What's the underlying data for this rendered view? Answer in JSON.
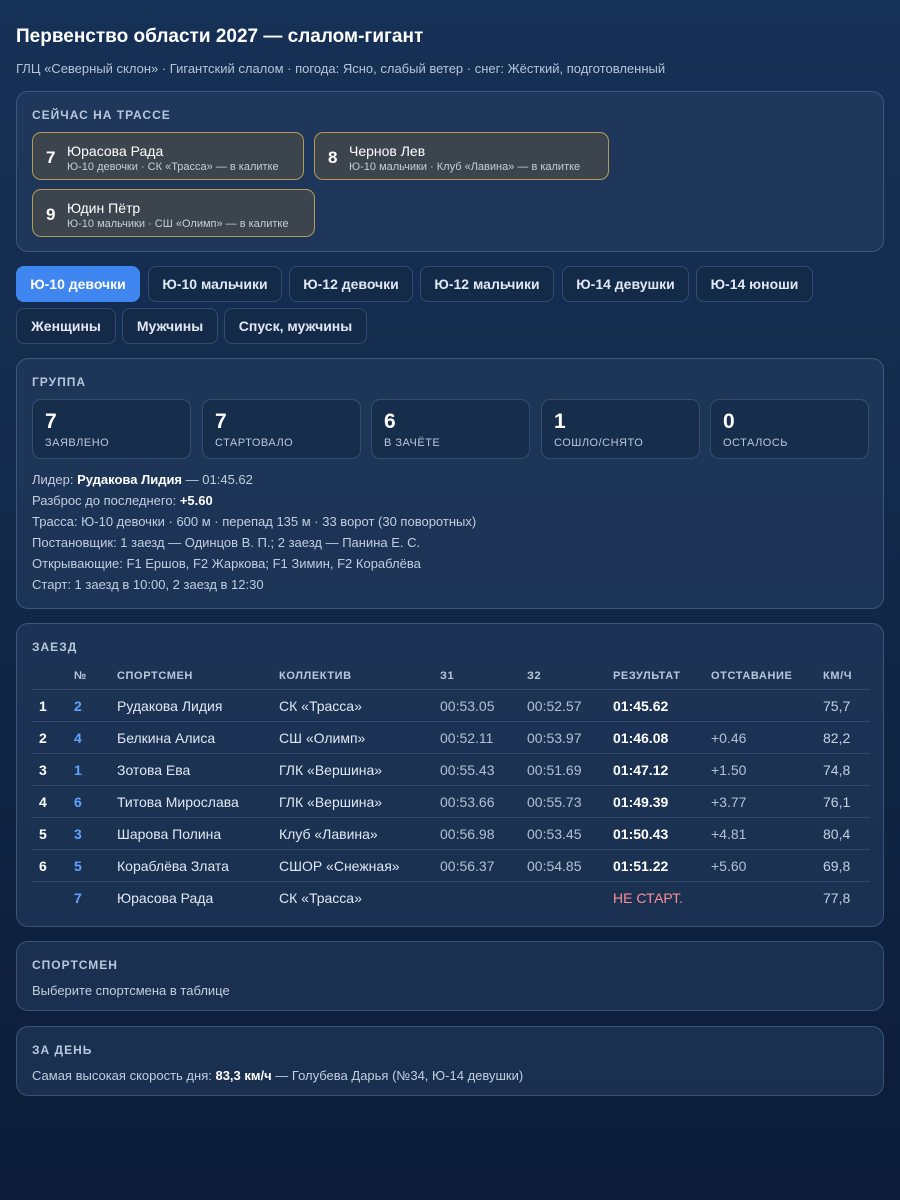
{
  "header": {
    "title": "Первенство области 2027 — слалом-гигант",
    "subtitle": "ГЛЦ «Северный склон» · Гигантский слалом · погода: Ясно, слабый ветер · снег: Жёсткий, подготовленный"
  },
  "on_course": {
    "title": "СЕЙЧАС НА ТРАССЕ",
    "cards": [
      {
        "bib": "7",
        "name": "Юрасова Рада",
        "meta": "Ю-10 девочки · СК «Трасса» — в калитке"
      },
      {
        "bib": "8",
        "name": "Чернов Лев",
        "meta": "Ю-10 мальчики · Клуб «Лавина» — в калитке"
      },
      {
        "bib": "9",
        "name": "Юдин Пётр",
        "meta": "Ю-10 мальчики · СШ «Олимп» — в калитке"
      }
    ]
  },
  "tabs": [
    {
      "label": "Ю-10 девочки",
      "active": true
    },
    {
      "label": "Ю-10 мальчики"
    },
    {
      "label": "Ю-12 девочки"
    },
    {
      "label": "Ю-12 мальчики"
    },
    {
      "label": "Ю-14 девушки"
    },
    {
      "label": "Ю-14 юноши"
    },
    {
      "label": "Женщины"
    },
    {
      "label": "Мужчины"
    },
    {
      "label": "Спуск, мужчины"
    }
  ],
  "group": {
    "title": "ГРУППА",
    "stats": [
      {
        "value": "7",
        "label": "ЗАЯВЛЕНО"
      },
      {
        "value": "7",
        "label": "СТАРТОВАЛО"
      },
      {
        "value": "6",
        "label": "В ЗАЧЁТЕ"
      },
      {
        "value": "1",
        "label": "СОШЛО/СНЯТО"
      },
      {
        "value": "0",
        "label": "ОСТАЛОСЬ"
      }
    ],
    "leader_label": "Лидер:",
    "leader_name": "Рудакова Лидия",
    "leader_time": "— 01:45.62",
    "spread_label": "Разброс до последнего:",
    "spread_value": "+5.60",
    "course": "Трасса: Ю-10 девочки · 600 м · перепад 135 м · 33 ворот (30 поворотных)",
    "setter": "Постановщик: 1 заезд — Одинцов В. П.; 2 заезд — Панина Е. С.",
    "forerunners": "Открывающие: F1 Ершов, F2 Жаркова; F1 Зимин, F2 Кораблёва",
    "start": "Старт: 1 заезд в 10:00, 2 заезд в 12:30"
  },
  "race": {
    "title": "ЗАЕЗД",
    "columns": {
      "bib": "№",
      "athlete": "СПОРТСМЕН",
      "club": "КОЛЛЕКТИВ",
      "run1": "З1",
      "run2": "З2",
      "result": "РЕЗУЛЬТАТ",
      "gap": "ОТСТАВАНИЕ",
      "speed": "КМ/Ч"
    },
    "rows": [
      {
        "place": "1",
        "bib": "2",
        "athlete": "Рудакова Лидия",
        "club": "СК «Трасса»",
        "run1": "00:53.05",
        "run2": "00:52.57",
        "result": "01:45.62",
        "gap": "",
        "speed": "75,7"
      },
      {
        "place": "2",
        "bib": "4",
        "athlete": "Белкина Алиса",
        "club": "СШ «Олимп»",
        "run1": "00:52.11",
        "run2": "00:53.97",
        "result": "01:46.08",
        "gap": "+0.46",
        "speed": "82,2"
      },
      {
        "place": "3",
        "bib": "1",
        "athlete": "Зотова Ева",
        "club": "ГЛК «Вершина»",
        "run1": "00:55.43",
        "run2": "00:51.69",
        "result": "01:47.12",
        "gap": "+1.50",
        "speed": "74,8"
      },
      {
        "place": "4",
        "bib": "6",
        "athlete": "Титова Мирослава",
        "club": "ГЛК «Вершина»",
        "run1": "00:53.66",
        "run2": "00:55.73",
        "result": "01:49.39",
        "gap": "+3.77",
        "speed": "76,1"
      },
      {
        "place": "5",
        "bib": "3",
        "athlete": "Шарова Полина",
        "club": "Клуб «Лавина»",
        "run1": "00:56.98",
        "run2": "00:53.45",
        "result": "01:50.43",
        "gap": "+4.81",
        "speed": "80,4"
      },
      {
        "place": "6",
        "bib": "5",
        "athlete": "Кораблёва Злата",
        "club": "СШОР «Снежная»",
        "run1": "00:56.37",
        "run2": "00:54.85",
        "result": "01:51.22",
        "gap": "+5.60",
        "speed": "69,8"
      },
      {
        "place": "",
        "bib": "7",
        "athlete": "Юрасова Рада",
        "club": "СК «Трасса»",
        "run1": "",
        "run2": "",
        "result": "НЕ СТАРТ.",
        "gap": "",
        "speed": "77,8",
        "dns": true
      }
    ]
  },
  "athlete_panel": {
    "title": "СПОРТСМЕН",
    "text": "Выберите спортсмена в таблице"
  },
  "day_panel": {
    "title": "ЗА ДЕНЬ",
    "prefix": "Самая высокая скорость дня:",
    "value": "83,3 км/ч",
    "suffix": "— Голубева Дарья (№34, Ю-14 девушки)"
  }
}
